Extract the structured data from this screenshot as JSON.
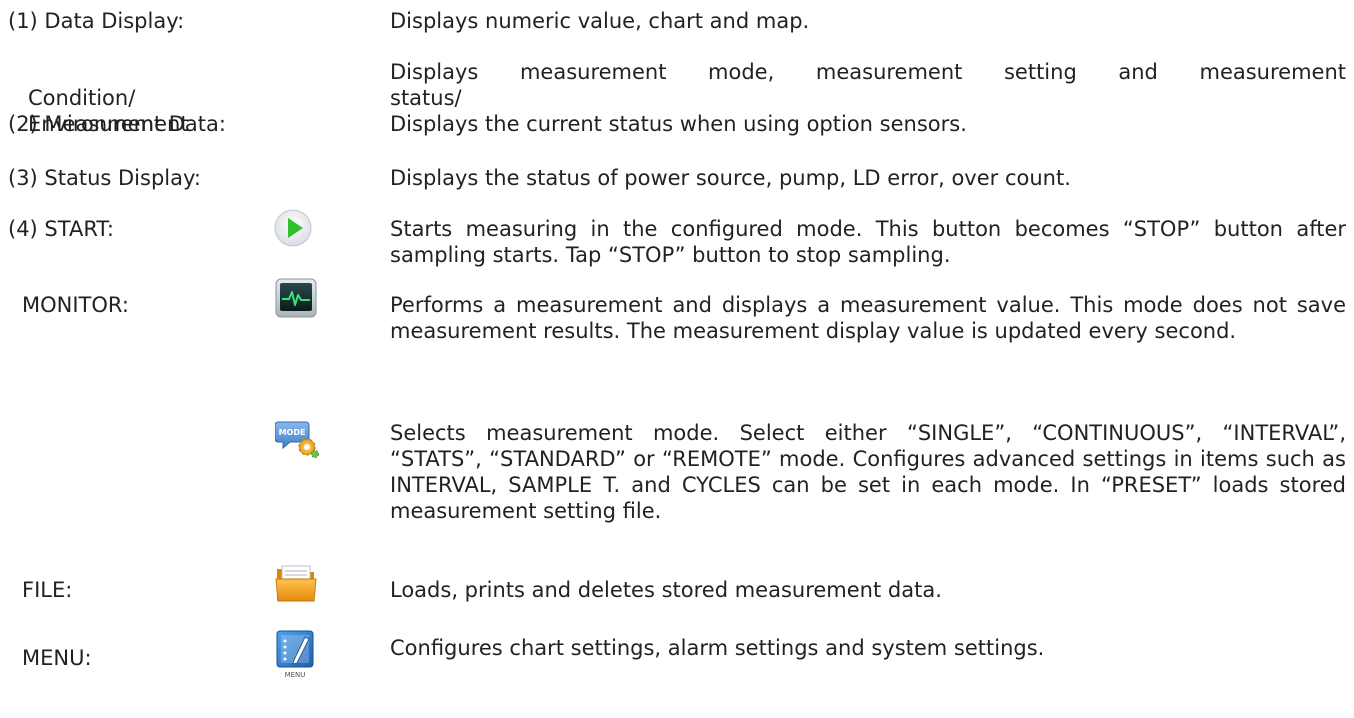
{
  "items": {
    "data_display": {
      "term": "(1) Data Display:",
      "desc": "Displays numeric value, chart and map."
    },
    "measurement_condition": {
      "term_line1": "(2) Measurement",
      "term_line2": "Condition/",
      "term_line3": "Environment Data:",
      "desc_line1": "Displays measurement mode, measurement setting and measurement",
      "desc_line2": "status/",
      "desc_line3": "Displays the current status when using option sensors."
    },
    "status_display": {
      "term": "(3) Status Display:",
      "desc": "Displays the status of power source, pump, LD error, over count."
    },
    "start": {
      "term": "(4) START:",
      "desc": "Starts measuring in the configured mode. This button becomes “STOP” button after sampling starts. Tap “STOP” button to stop sampling.",
      "icon": "play-icon"
    },
    "monitor": {
      "term": "MONITOR:",
      "desc": "Performs a measurement and displays a measurement value. This mode does not save measurement results. The measurement display value is updated every second.",
      "icon": "monitor-icon"
    },
    "mode": {
      "desc": "Selects measurement mode. Select either “SINGLE”, “CONTINUOUS”, “INTERVAL”, “STATS”, “STANDARD” or “REMOTE” mode. Configures advanced settings in items such as INTERVAL, SAMPLE T. and CYCLES can be set in each mode. In “PRESET” loads stored measurement setting file.",
      "icon": "mode-icon",
      "icon_text": "MODE"
    },
    "file": {
      "term": "FILE:",
      "desc": "Loads, prints and deletes stored measurement data.",
      "icon": "folder-icon"
    },
    "menu": {
      "term": "MENU:",
      "desc": "Configures chart settings, alarm settings and system settings.",
      "icon": "menu-icon",
      "icon_text": "MENU"
    }
  },
  "colors": {
    "text": "#222222",
    "play_green": "#2fbf2f",
    "monitor_green": "#39e07a",
    "folder_orange": "#f0a020",
    "menu_blue": "#2e7fd6"
  }
}
